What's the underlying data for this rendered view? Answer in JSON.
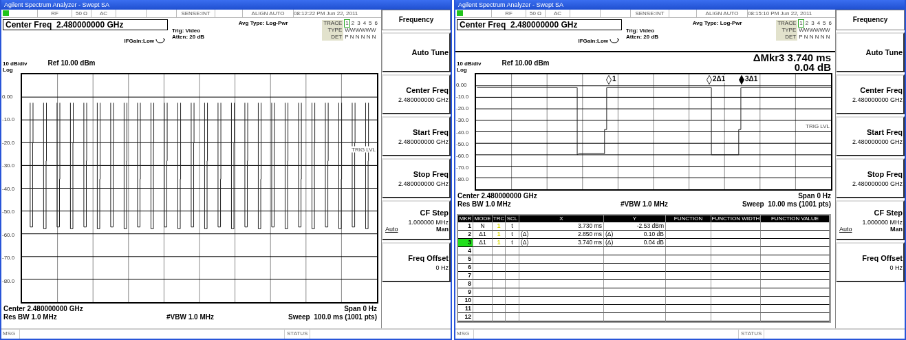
{
  "windows": [
    {
      "title": "Agilent Spectrum Analyzer - Swept SA",
      "status_bar": [
        "RF",
        "50 Ω",
        "AC",
        "SENSE:INT",
        "ALIGN AUTO",
        "08:12:22 PM Jun 22, 2011"
      ],
      "center_freq": "Center Freq  2.480000000 GHz",
      "if_gain": "IFGain:Low",
      "trig": "Trig: Video",
      "atten": "Atten: 20 dB",
      "avg_type": "Avg Type: Log-Pwr",
      "trace_table": {
        "label": "TRACE",
        "traces": [
          {
            "label": "1",
            "selected": true
          },
          {
            "label": "2",
            "selected": false
          },
          {
            "label": "3",
            "selected": false
          },
          {
            "label": "4",
            "selected": false
          },
          {
            "label": "5",
            "selected": false
          },
          {
            "label": "6",
            "selected": false
          }
        ],
        "rows": [
          {
            "label": "TYPE",
            "values": "WWWWWW"
          },
          {
            "label": "DET",
            "values": "P N N N N N"
          }
        ]
      },
      "scale": "10 dB/div",
      "ref": "Ref 10.00 dBm",
      "log": "Log",
      "y_labels": [
        "0.00",
        "-10.0",
        "-20.0",
        "-30.0",
        "-40.0",
        "-50.0",
        "-60.0",
        "-70.0",
        "-80.0"
      ],
      "trig_level": "TRIG LVL",
      "center": "Center 2.480000000 GHz",
      "span": "Span 0 Hz",
      "res_bw": "Res BW 1.0 MHz",
      "vbw": "#VBW 1.0 MHz",
      "sweep": "Sweep  100.0 ms (1001 pts)",
      "softkeys": [
        {
          "kind": "title",
          "label": "Frequency"
        },
        {
          "kind": "key",
          "label": "Auto Tune"
        },
        {
          "kind": "key",
          "label": "Center Freq",
          "value": "2.480000000 GHz"
        },
        {
          "kind": "key",
          "label": "Start Freq",
          "value": "2.480000000 GHz"
        },
        {
          "kind": "key",
          "label": "Stop Freq",
          "value": "2.480000000 GHz"
        },
        {
          "kind": "key",
          "label": "CF Step",
          "value": "1.000000 MHz",
          "options": [
            {
              "label": "Auto",
              "selected": true
            },
            {
              "label": "Man",
              "selected": false
            }
          ]
        },
        {
          "kind": "key",
          "label": "Freq Offset",
          "value": "0 Hz"
        }
      ],
      "message_bar": {
        "msg": "MSG",
        "status": "STATUS"
      }
    },
    {
      "title": "Agilent Spectrum Analyzer - Swept SA",
      "status_bar": [
        "RF",
        "50 Ω",
        "AC",
        "SENSE:INT",
        "ALIGN AUTO",
        "08:15:10 PM Jun 22, 2011"
      ],
      "center_freq": "Center Freq  2.480000000 GHz",
      "if_gain": "IFGain:Low",
      "trig": "Trig: Video",
      "atten": "Atten: 20 dB",
      "avg_type": "Avg Type: Log-Pwr",
      "trace_table": {
        "label": "TRACE",
        "traces": [
          {
            "label": "1",
            "selected": true
          },
          {
            "label": "2",
            "selected": false
          },
          {
            "label": "3",
            "selected": false
          },
          {
            "label": "4",
            "selected": false
          },
          {
            "label": "5",
            "selected": false
          },
          {
            "label": "6",
            "selected": false
          }
        ],
        "rows": [
          {
            "label": "TYPE",
            "values": "WWWWWW"
          },
          {
            "label": "DET",
            "values": "P N N N N N"
          }
        ]
      },
      "marker_readout": [
        "ΔMkr3 3.740 ms",
        "0.04 dB"
      ],
      "scale": "10 dB/div",
      "ref": "Ref 10.00 dBm",
      "log": "Log",
      "y_labels": [
        "0.00",
        "-10.0",
        "-20.0",
        "-30.0",
        "-40.0",
        "-50.0",
        "-60.0",
        "-70.0",
        "-80.0"
      ],
      "trig_level": "TRIG LVL",
      "markers": [
        {
          "label": "1",
          "selected": false
        },
        {
          "label": "2Δ1",
          "selected": false
        },
        {
          "label": "3Δ1",
          "selected": true
        }
      ],
      "center": "Center 2.480000000 GHz",
      "span": "Span 0 Hz",
      "res_bw": "Res BW 1.0 MHz",
      "vbw": "#VBW 1.0 MHz",
      "sweep": "Sweep  10.00 ms (1001 pts)",
      "marker_table": {
        "columns": [
          "MKR",
          "MODE",
          "TRC",
          "SCL",
          "X",
          "Y",
          "FUNCTION",
          "FUNCTION WIDTH",
          "FUNCTION VALUE"
        ],
        "rows": [
          {
            "mkr": "1",
            "mode": "N",
            "trc": "1",
            "scl": "t",
            "x": "3.730 ms",
            "y": "-2.53 dBm",
            "selected": false
          },
          {
            "mkr": "2",
            "mode": "Δ1",
            "trc": "1",
            "scl": "t",
            "x_ref": "(Δ)",
            "x": "2.850 ms",
            "y_ref": "(Δ)",
            "y": "0.10 dB",
            "selected": false
          },
          {
            "mkr": "3",
            "mode": "Δ1",
            "trc": "1",
            "scl": "t",
            "x_ref": "(Δ)",
            "x": "3.740 ms",
            "y_ref": "(Δ)",
            "y": "0.04 dB",
            "selected": true
          },
          {
            "mkr": "4",
            "selected": false
          },
          {
            "mkr": "5",
            "selected": false
          },
          {
            "mkr": "6",
            "selected": false
          },
          {
            "mkr": "7",
            "selected": false
          },
          {
            "mkr": "8",
            "selected": false
          },
          {
            "mkr": "9",
            "selected": false
          },
          {
            "mkr": "10",
            "selected": false
          },
          {
            "mkr": "11",
            "selected": false
          },
          {
            "mkr": "12",
            "selected": false
          }
        ]
      },
      "softkeys": [
        {
          "kind": "title",
          "label": "Frequency"
        },
        {
          "kind": "key",
          "label": "Auto Tune"
        },
        {
          "kind": "key",
          "label": "Center Freq",
          "value": "2.480000000 GHz"
        },
        {
          "kind": "key",
          "label": "Start Freq",
          "value": "2.480000000 GHz"
        },
        {
          "kind": "key",
          "label": "Stop Freq",
          "value": "2.480000000 GHz"
        },
        {
          "kind": "key",
          "label": "CF Step",
          "value": "1.000000 MHz",
          "options": [
            {
              "label": "Auto",
              "selected": true
            },
            {
              "label": "Man",
              "selected": false
            }
          ]
        },
        {
          "kind": "key",
          "label": "Freq Offset",
          "value": "0 Hz"
        }
      ],
      "message_bar": {
        "msg": "MSG",
        "status": "STATUS"
      }
    }
  ]
}
